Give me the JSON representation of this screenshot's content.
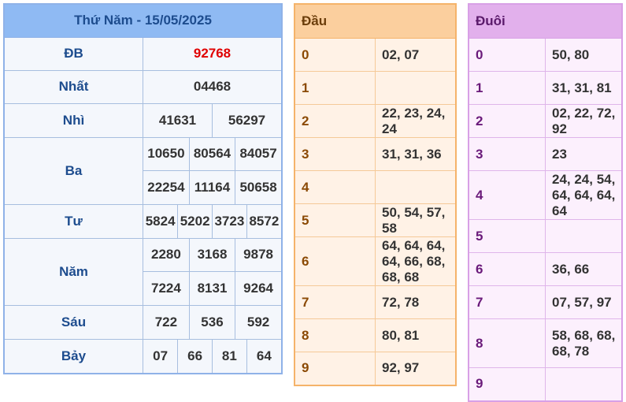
{
  "main": {
    "title": "Thứ Năm - 15/05/2025",
    "prizes": [
      {
        "label": "ĐB",
        "numbers": [
          "92768"
        ]
      },
      {
        "label": "Nhất",
        "numbers": [
          "04468"
        ]
      },
      {
        "label": "Nhì",
        "numbers": [
          "41631",
          "56297"
        ]
      },
      {
        "label": "Ba",
        "numbers": [
          "10650",
          "80564",
          "84057",
          "22254",
          "11164",
          "50658"
        ]
      },
      {
        "label": "Tư",
        "numbers": [
          "5824",
          "5202",
          "3723",
          "8572"
        ]
      },
      {
        "label": "Năm",
        "numbers": [
          "2280",
          "3168",
          "9878",
          "7224",
          "8131",
          "9264"
        ]
      },
      {
        "label": "Sáu",
        "numbers": [
          "722",
          "536",
          "592"
        ]
      },
      {
        "label": "Bảy",
        "numbers": [
          "07",
          "66",
          "81",
          "64"
        ]
      }
    ]
  },
  "dau": {
    "header": "Đầu",
    "rows": [
      {
        "key": "0",
        "value": "02, 07"
      },
      {
        "key": "1",
        "value": ""
      },
      {
        "key": "2",
        "value": "22, 23, 24, 24"
      },
      {
        "key": "3",
        "value": "31, 31, 36"
      },
      {
        "key": "4",
        "value": ""
      },
      {
        "key": "5",
        "value": "50, 54, 57, 58"
      },
      {
        "key": "6",
        "value": "64, 64, 64, 64, 66, 68, 68, 68"
      },
      {
        "key": "7",
        "value": "72, 78"
      },
      {
        "key": "8",
        "value": "80, 81"
      },
      {
        "key": "9",
        "value": "92, 97"
      }
    ]
  },
  "duoi": {
    "header": "Đuôi",
    "rows": [
      {
        "key": "0",
        "value": "50, 80"
      },
      {
        "key": "1",
        "value": "31, 31, 81"
      },
      {
        "key": "2",
        "value": "02, 22, 72, 92"
      },
      {
        "key": "3",
        "value": "23"
      },
      {
        "key": "4",
        "value": "24, 24, 54, 64, 64, 64, 64"
      },
      {
        "key": "5",
        "value": ""
      },
      {
        "key": "6",
        "value": "36, 66"
      },
      {
        "key": "7",
        "value": "07, 57, 97"
      },
      {
        "key": "8",
        "value": "58, 68, 68, 68, 78"
      },
      {
        "key": "9",
        "value": ""
      }
    ]
  }
}
